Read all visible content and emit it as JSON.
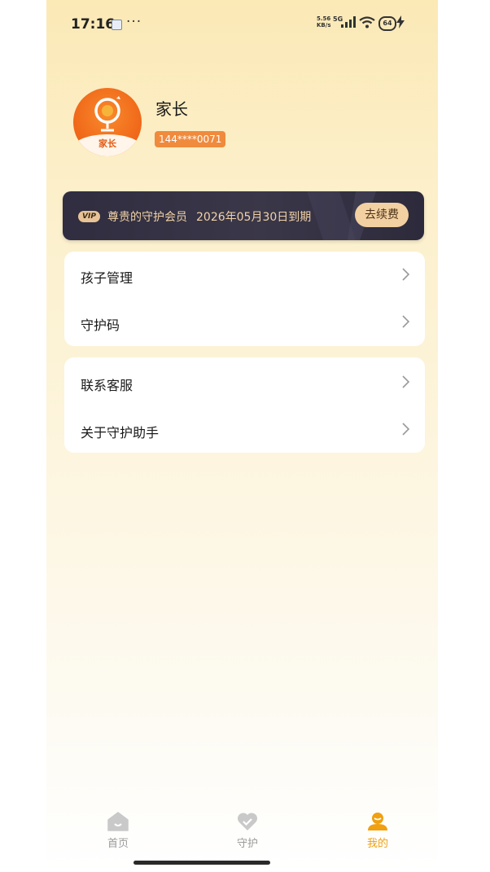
{
  "status_bar": {
    "time": "17:16",
    "net_speed_value": "5.56",
    "net_speed_unit": "KB/s",
    "network": "5G",
    "battery": "64"
  },
  "profile": {
    "avatar_label": "家长",
    "name": "家长",
    "phone": "144****0071"
  },
  "vip": {
    "tag": "VIP",
    "title": "尊贵的守护会员",
    "expire_text": "2026年05月30日到期",
    "renew_button": "去续费"
  },
  "menu_group1": [
    {
      "label": "孩子管理"
    },
    {
      "label": "守护码"
    }
  ],
  "menu_group2": [
    {
      "label": "联系客服"
    },
    {
      "label": "关于守护助手"
    }
  ],
  "tabs": [
    {
      "label": "首页",
      "icon": "home-icon"
    },
    {
      "label": "守护",
      "icon": "heart-icon"
    },
    {
      "label": "我的",
      "icon": "profile-icon",
      "active": true
    }
  ],
  "colors": {
    "accent": "#f0a010",
    "avatar_bg": "#ef6518",
    "phone_badge": "#f08a3c",
    "vip_card_bg": "#2f2d3f",
    "vip_text": "#f2d2a6"
  }
}
